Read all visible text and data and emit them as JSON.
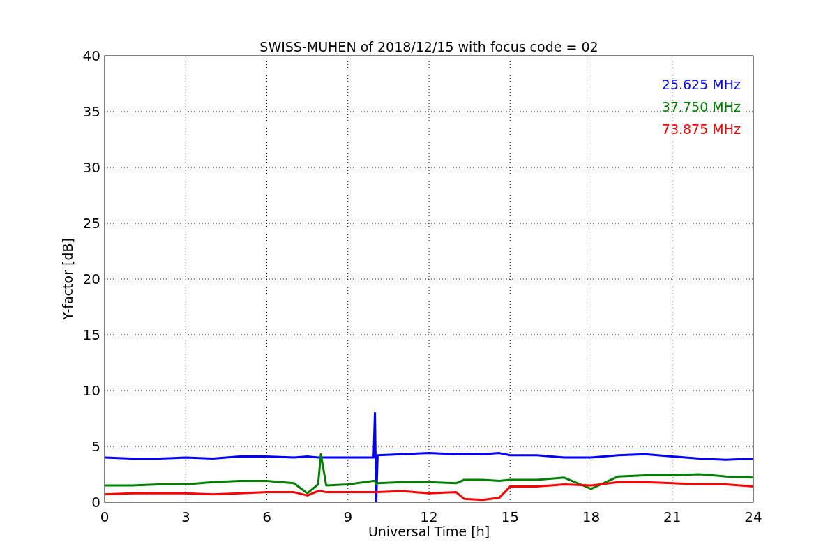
{
  "chart_data": {
    "type": "line",
    "title": "SWISS-MUHEN of 2018/12/15 with focus code = 02",
    "xlabel": "Universal Time [h]",
    "ylabel": "Y-factor [dB]",
    "x": [
      0,
      1,
      2,
      3,
      4,
      5,
      6,
      7,
      7.5,
      7.9,
      8,
      8.2,
      9,
      9.95,
      10,
      10.05,
      10.1,
      11,
      12,
      13,
      13.3,
      14,
      14.6,
      15,
      16,
      17,
      18,
      19,
      20,
      21,
      22,
      23,
      24
    ],
    "series": [
      {
        "name": "25.625 MHz",
        "color": "#0000ff",
        "values": [
          4.0,
          3.9,
          3.9,
          4.0,
          3.9,
          4.1,
          4.1,
          4.0,
          4.1,
          4.0,
          4.0,
          4.0,
          4.0,
          4.0,
          8.0,
          0.1,
          4.2,
          4.3,
          4.4,
          4.3,
          4.3,
          4.3,
          4.4,
          4.2,
          4.2,
          4.0,
          4.0,
          4.2,
          4.3,
          4.1,
          3.9,
          3.8,
          3.9
        ]
      },
      {
        "name": "37.750 MHz",
        "color": "#008000",
        "values": [
          1.5,
          1.5,
          1.6,
          1.6,
          1.8,
          1.9,
          1.9,
          1.7,
          0.8,
          1.6,
          4.3,
          1.5,
          1.6,
          1.9,
          1.9,
          1.6,
          1.7,
          1.8,
          1.8,
          1.7,
          2.0,
          2.0,
          1.9,
          2.0,
          2.0,
          2.2,
          1.2,
          2.3,
          2.4,
          2.4,
          2.5,
          2.3,
          2.2
        ]
      },
      {
        "name": "73.875 MHz",
        "color": "#ff0000",
        "values": [
          0.7,
          0.8,
          0.8,
          0.8,
          0.7,
          0.8,
          0.9,
          0.9,
          0.6,
          1.0,
          1.0,
          0.9,
          0.9,
          0.9,
          0.9,
          0.9,
          0.9,
          1.0,
          0.8,
          0.9,
          0.3,
          0.2,
          0.4,
          1.4,
          1.4,
          1.6,
          1.5,
          1.8,
          1.8,
          1.7,
          1.6,
          1.6,
          1.4
        ]
      }
    ],
    "xlim": [
      0,
      24
    ],
    "ylim": [
      0,
      40
    ],
    "xticks": [
      0,
      3,
      6,
      9,
      12,
      15,
      18,
      21,
      24
    ],
    "yticks": [
      0,
      5,
      10,
      15,
      20,
      25,
      30,
      35,
      40
    ],
    "grid": true
  }
}
